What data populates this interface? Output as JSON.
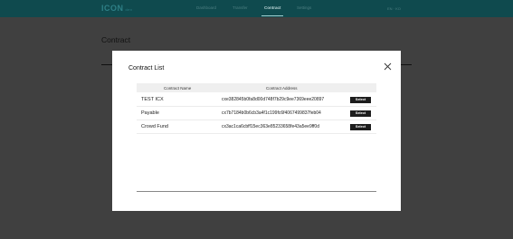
{
  "header": {
    "logo": "ICON",
    "logo_suffix": "dev",
    "nav": [
      {
        "label": "Dashboard",
        "active": false
      },
      {
        "label": "Transfer",
        "active": false
      },
      {
        "label": "Contract",
        "active": true
      },
      {
        "label": "Settings",
        "active": false
      }
    ],
    "lang": "EN · KO"
  },
  "page": {
    "title": "Contract"
  },
  "modal": {
    "title": "Contract List",
    "close_icon": "close-icon",
    "columns": [
      "Contract Name",
      "Contract Address"
    ],
    "rows": [
      {
        "name": "TEST ICX",
        "address": "cxe382845b0fa8d00d748f7b29c9ee7369eee20897",
        "action": "Select"
      },
      {
        "name": "Payable",
        "address": "cx7b7184b0b6cb3a4f1c199fc6f4067499837feb04",
        "action": "Select"
      },
      {
        "name": "Crowd Fund",
        "address": "cx3ac1ca6cbff15ec363e85233658fe43a5ee9ff0d",
        "action": "Select"
      }
    ]
  },
  "colors": {
    "header_bg": "#0f4a4e",
    "overlay": "#3a3a3a",
    "button_bg": "#1d1d1d"
  }
}
